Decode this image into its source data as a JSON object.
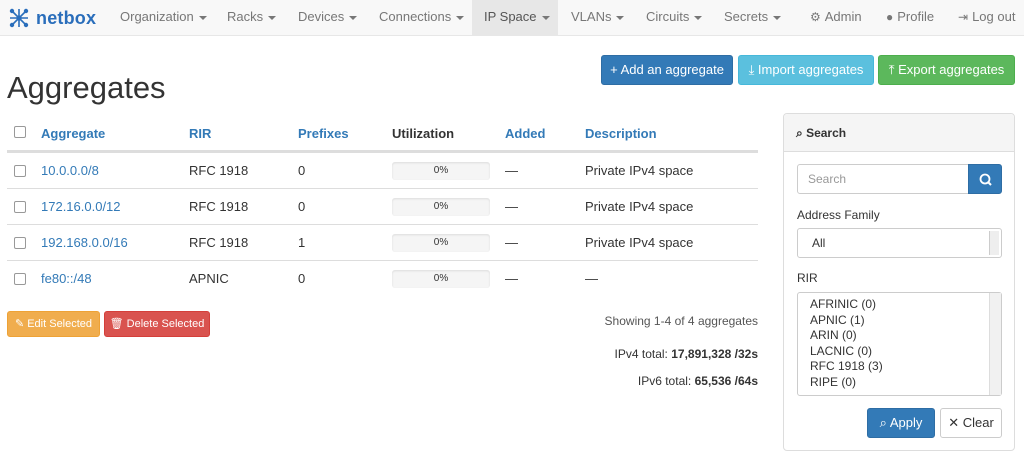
{
  "brand": {
    "name": "netbox"
  },
  "nav": {
    "items": [
      {
        "label": "Organization"
      },
      {
        "label": "Racks"
      },
      {
        "label": "Devices"
      },
      {
        "label": "Connections"
      },
      {
        "label": "IP Space"
      },
      {
        "label": "VLANs"
      },
      {
        "label": "Circuits"
      },
      {
        "label": "Secrets"
      }
    ],
    "admin": "Admin",
    "profile": "Profile",
    "logout": "Log out"
  },
  "page": {
    "title": "Aggregates"
  },
  "actions": {
    "add": "Add an aggregate",
    "import": "Import aggregates",
    "export": "Export aggregates"
  },
  "table": {
    "headers": [
      "Aggregate",
      "RIR",
      "Prefixes",
      "Utilization",
      "Added",
      "Description"
    ],
    "rows": [
      {
        "aggregate": "10.0.0.0/8",
        "rir": "RFC 1918",
        "prefixes": "0",
        "utilization": "0%",
        "added": "—",
        "description": "Private IPv4 space"
      },
      {
        "aggregate": "172.16.0.0/12",
        "rir": "RFC 1918",
        "prefixes": "0",
        "utilization": "0%",
        "added": "—",
        "description": "Private IPv4 space"
      },
      {
        "aggregate": "192.168.0.0/16",
        "rir": "RFC 1918",
        "prefixes": "1",
        "utilization": "0%",
        "added": "—",
        "description": "Private IPv4 space"
      },
      {
        "aggregate": "fe80::/48",
        "rir": "APNIC",
        "prefixes": "0",
        "utilization": "0%",
        "added": "—",
        "description": "—"
      }
    ]
  },
  "bulk": {
    "edit": "Edit Selected",
    "delete": "Delete Selected"
  },
  "summary": {
    "showing": "Showing 1-4 of 4 aggregates",
    "ipv4_label": "IPv4 total:",
    "ipv4_value": "17,891,328 /32s",
    "ipv6_label": "IPv6 total:",
    "ipv6_value": "65,536 /64s"
  },
  "search": {
    "title": "Search",
    "placeholder": "Search",
    "family_label": "Address Family",
    "family_value": "All",
    "rir_label": "RIR",
    "rir_options": [
      "AFRINIC (0)",
      "APNIC (1)",
      "ARIN (0)",
      "LACNIC (0)",
      "RFC 1918 (3)",
      "RIPE (0)"
    ],
    "apply": "Apply",
    "clear": "Clear"
  },
  "colors": {
    "primary": "#337ab7",
    "info": "#5bc0de",
    "success": "#5cb85c",
    "warning": "#f0ad4e",
    "danger": "#d9534f",
    "navbar": "#f8f8f8"
  }
}
